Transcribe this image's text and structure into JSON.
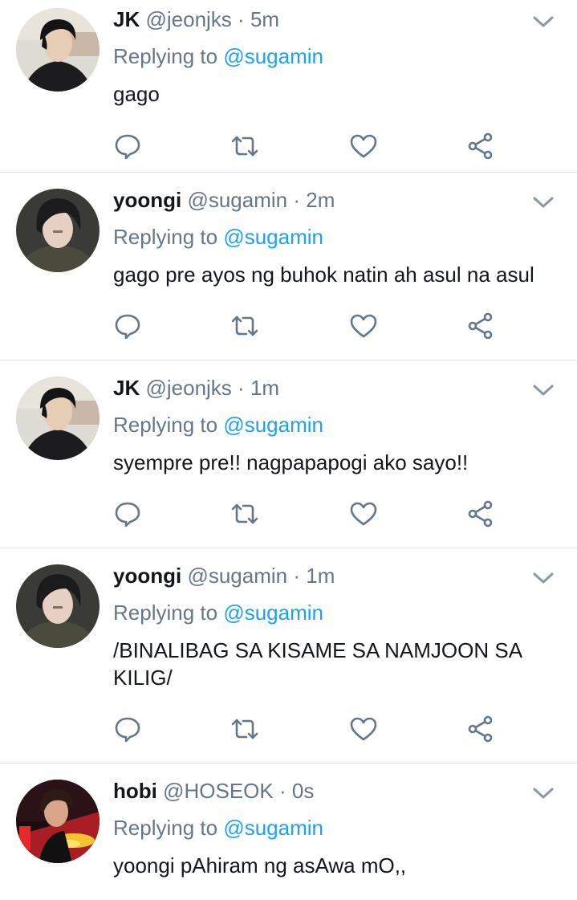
{
  "tweets": [
    {
      "name": "JK",
      "handle": "@jeonjks",
      "separator": "·",
      "time": "5m",
      "replying_prefix": "Replying to",
      "replying_to": "@sugamin",
      "text": "gago",
      "avatar": "jk-avatar"
    },
    {
      "name": "yoongi",
      "handle": "@sugamin",
      "separator": "·",
      "time": "2m",
      "replying_prefix": "Replying to",
      "replying_to": "@sugamin",
      "text": "gago pre ayos ng buhok natin ah asul na asul",
      "avatar": "yoongi-avatar"
    },
    {
      "name": "JK",
      "handle": "@jeonjks",
      "separator": "·",
      "time": "1m",
      "replying_prefix": "Replying to",
      "replying_to": "@sugamin",
      "text": "syempre pre!! nagpapapogi ako sayo!!",
      "avatar": "jk-avatar"
    },
    {
      "name": "yoongi",
      "handle": "@sugamin",
      "separator": "·",
      "time": "1m",
      "replying_prefix": "Replying to",
      "replying_to": "@sugamin",
      "text": "/BINALIBAG SA KISAME SA NAMJOON SA KILIG/",
      "avatar": "yoongi-avatar"
    },
    {
      "name": "hobi",
      "handle": "@HOSEOK",
      "separator": "·",
      "time": "0s",
      "replying_prefix": "Replying to",
      "replying_to": "@sugamin",
      "text": "yoongi pAhiram ng asAwa mO,,",
      "avatar": "hobi-avatar"
    }
  ],
  "icons": {
    "reply": "reply-icon",
    "retweet": "retweet-icon",
    "like": "heart-icon",
    "share": "share-icon",
    "menu": "chevron-down-icon"
  },
  "colors": {
    "text": "#14171a",
    "secondary": "#657786",
    "link": "#1da1f2",
    "divider": "#dfe3e7"
  }
}
